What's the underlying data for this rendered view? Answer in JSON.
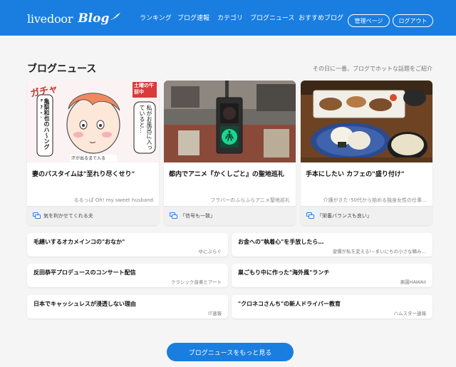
{
  "header": {
    "logo_livedoor": "livedoor",
    "logo_blog": "Blog",
    "nav": [
      "ランキング",
      "ブログ速報",
      "カテゴリ",
      "ブログニュース",
      "おすすめブログ"
    ],
    "buttons": [
      "管理ページ",
      "ログアウト"
    ]
  },
  "section": {
    "title": "ブログニュース",
    "description": "その日に一番、ブログでホットな話題をご紹介"
  },
  "cards": [
    {
      "title": "妻のバスタイムは\"至れり尽くせり\"",
      "source": "るるっぱ Oh! my sweet husband",
      "comment": "気を利かせてくれる夫",
      "image_text": {
        "gacha": "ガチャ",
        "badge": "土曜の午前中",
        "bubble_left": "亀梨和也のハ～ングアウト♪",
        "bubble_right": "私がお風呂に入っていると…",
        "caption": "汗が出るまで入る"
      }
    },
    {
      "title": "都内でアニメ『かくしごと』の聖地巡礼",
      "source": "フラバーのふらふらアニメ聖地巡礼",
      "comment": "「信号も一致」"
    },
    {
      "title": "手本にしたい カフェの\"盛り付け\"",
      "source": "介護がきた･50代から始める独身女性の仕事…",
      "comment": "「栄養バランスも良い」"
    }
  ],
  "news": [
    {
      "title": "毛繕いするオカメインコの\"おなか\"",
      "source": "ゆにぷらぐ"
    },
    {
      "title": "お金への\"執着心\"を手放したら…",
      "source": "習慣が私を変える!~まいにちの小さな積み…"
    },
    {
      "title": "反田恭平プロデュースのコンサート配信",
      "source": "クラシック音楽とアート"
    },
    {
      "title": "巣ごもり中に作った\"海外風\"ランチ",
      "source": "楽園HAWAII"
    },
    {
      "title": "日本でキャッシュレスが浸透しない理由",
      "source": "IT速報"
    },
    {
      "title": "\"クロネコさんち\"の新人ドライバー教育",
      "source": "ハムスター速報"
    }
  ],
  "more_button": "ブログニュースをもっと見る",
  "colors": {
    "brand": "#1a7ee0",
    "background": "#f5f5f5"
  }
}
